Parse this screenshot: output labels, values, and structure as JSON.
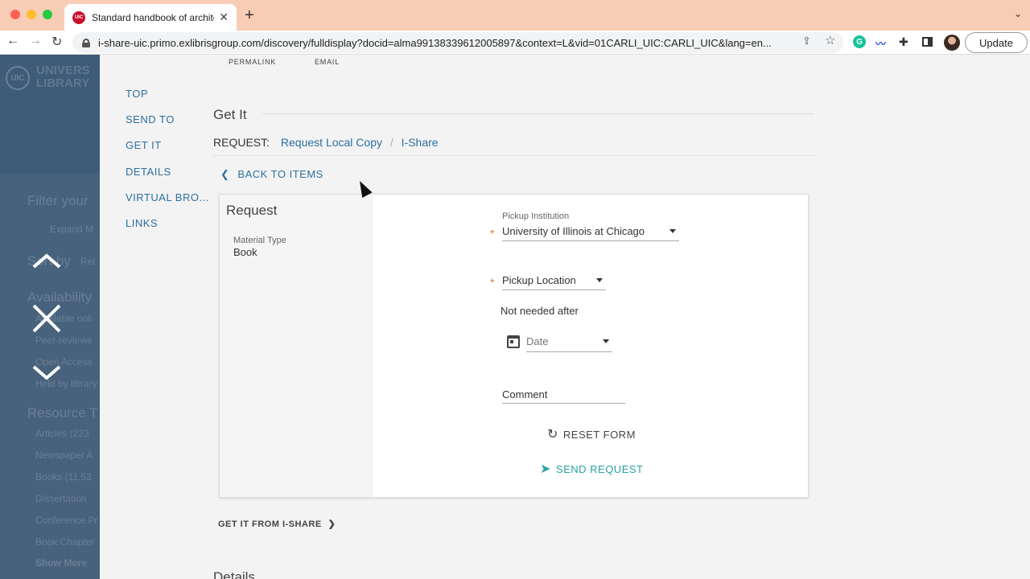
{
  "browser": {
    "tab_title": "Standard handbook of architec",
    "tab_favicon_text": "UIC",
    "url": "i-share-uic.primo.exlibrisgroup.com/discovery/fulldisplay?docid=alma99138339612005897&context=L&vid=01CARLI_UIC:CARLI_UIC&lang=en...",
    "update_label": "Update",
    "grammarly_label": "G"
  },
  "left_panel": {
    "logo_text": "UIC",
    "brand_line1": "UNIVERS",
    "brand_line2": "LIBRARY",
    "ghost": [
      "Filter your",
      "Expand M",
      "Sort by",
      "Rel",
      "Availability",
      "Available onli",
      "Peer-reviewe",
      "Open Access",
      "Held by library",
      "Resource T",
      "Articles (223",
      "Newspaper A",
      "Books (11,53",
      "Dissertation",
      "Conference Pr",
      "Book Chapter",
      "Show More"
    ]
  },
  "side_nav": [
    "TOP",
    "SEND TO",
    "GET IT",
    "DETAILS",
    "VIRTUAL BRO...",
    "LINKS"
  ],
  "top_actions": [
    "PERMALINK",
    "EMAIL"
  ],
  "get_it": {
    "title": "Get It",
    "request_label": "REQUEST:",
    "request_local": "Request Local Copy",
    "separator": "/",
    "request_ishare": "I-Share",
    "back_label": "BACK TO ITEMS"
  },
  "form": {
    "title": "Request",
    "material_type_label": "Material Type",
    "material_type_value": "Book",
    "pickup_institution_label": "Pickup Institution",
    "pickup_institution_value": "University of Illinois at Chicago",
    "pickup_location_value": "Pickup Location",
    "not_needed_label": "Not needed after",
    "date_placeholder": "Date",
    "comment_label": "Comment",
    "reset_label": "RESET FORM",
    "send_label": "SEND REQUEST",
    "required_mark": "*"
  },
  "get_it_from_ishare": "GET IT FROM I-SHARE",
  "details_heading": "Details"
}
